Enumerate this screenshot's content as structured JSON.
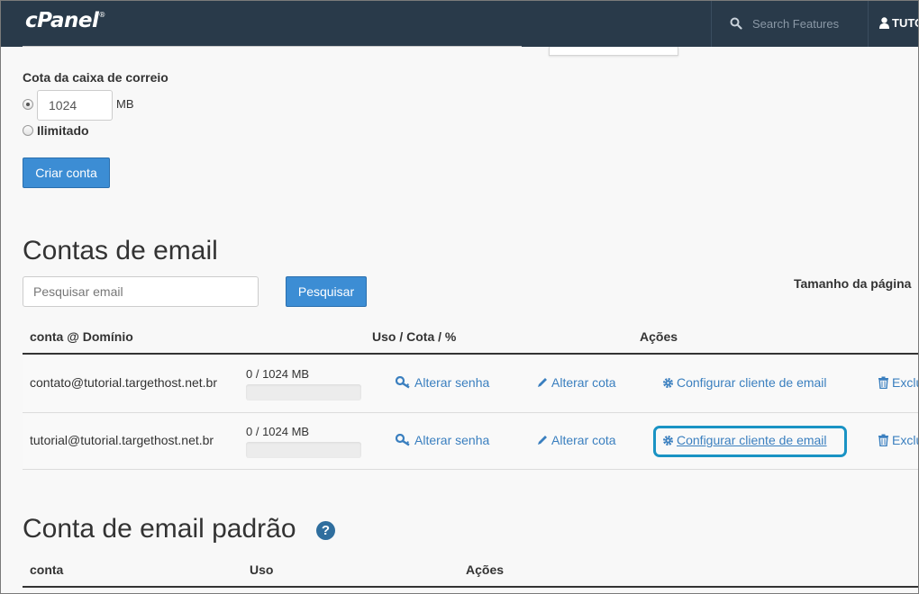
{
  "topbar": {
    "logo": "cPanel",
    "logo_mark": "®",
    "search_placeholder": "Search Features",
    "user": "TUTO"
  },
  "quota": {
    "label": "Cota da caixa de correio",
    "value": "1024",
    "unit": "MB",
    "unlimited_label": "Ilimitado",
    "create_button": "Criar conta"
  },
  "accounts": {
    "title": "Contas de email",
    "search_placeholder": "Pesquisar email",
    "search_button": "Pesquisar",
    "page_size_label": "Tamanho da página",
    "headers": {
      "account": "conta @ Domínio",
      "usage": "Uso / Cota / %",
      "actions": "Ações"
    },
    "rows": [
      {
        "email": "contato@tutorial.targethost.net.br",
        "usage": "0 / 1024 MB",
        "usage_fraction": 0,
        "change_password": "Alterar senha",
        "change_quota": "Alterar cota",
        "configure_client": "Configurar cliente de email",
        "delete": "Exclu"
      },
      {
        "email": "tutorial@tutorial.targethost.net.br",
        "usage": "0 / 1024 MB",
        "usage_fraction": 0,
        "change_password": "Alterar senha",
        "change_quota": "Alterar cota",
        "configure_client": "Configurar cliente de email",
        "delete": "Exclu"
      }
    ]
  },
  "default_account": {
    "title": "Conta de email padrão",
    "help_glyph": "?",
    "headers": {
      "account": "conta",
      "usage": "Uso",
      "actions": "Ações"
    }
  },
  "colors": {
    "topbar": "#293a4a",
    "primary_button": "#3c8dd4",
    "link": "#3a7fbf",
    "highlight": "#1a93c4"
  }
}
